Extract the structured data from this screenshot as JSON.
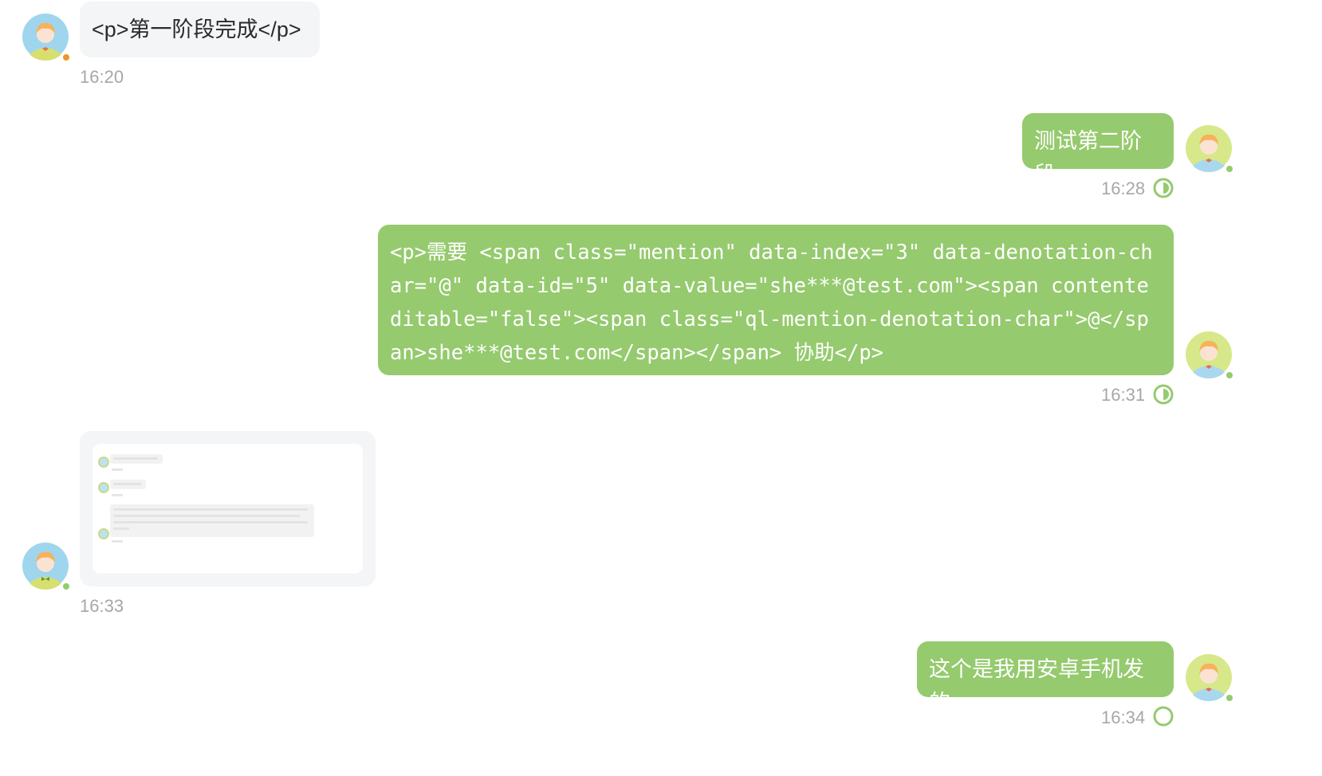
{
  "colors": {
    "left_bubble": "#f4f5f7",
    "right_bubble": "#95ca6e",
    "timestamp": "#a7a7a7",
    "status_green": "#95ca6e",
    "online_dot_green": "#95ca6e",
    "away_dot_orange": "#f0932b"
  },
  "messages": [
    {
      "side": "left",
      "text": "<p>第一阶段完成</p>",
      "time": "16:20",
      "avatar_status": "away"
    },
    {
      "side": "right",
      "text": "测试第二阶段",
      "time": "16:28",
      "read_status_icon": "half-read-circle-icon"
    },
    {
      "side": "right",
      "text": "<p>需要 <span class=\"mention\" data-index=\"3\" data-denotation-char=\"@\" data-id=\"5\" data-value=\"she***@test.com\"><span contenteditable=\"false\"><span class=\"ql-mention-denotation-char\">@</span>she***@test.com</span></span> 协助</p>",
      "time": "16:31",
      "read_status_icon": "half-read-circle-icon"
    },
    {
      "side": "left",
      "type": "image",
      "image_description_icon": "screenshot-thumbnail",
      "time": "16:33",
      "avatar_status": "online"
    },
    {
      "side": "right",
      "text": "这个是我用安卓手机发的",
      "time": "16:34",
      "read_status_icon": "unread-circle-icon"
    }
  ]
}
